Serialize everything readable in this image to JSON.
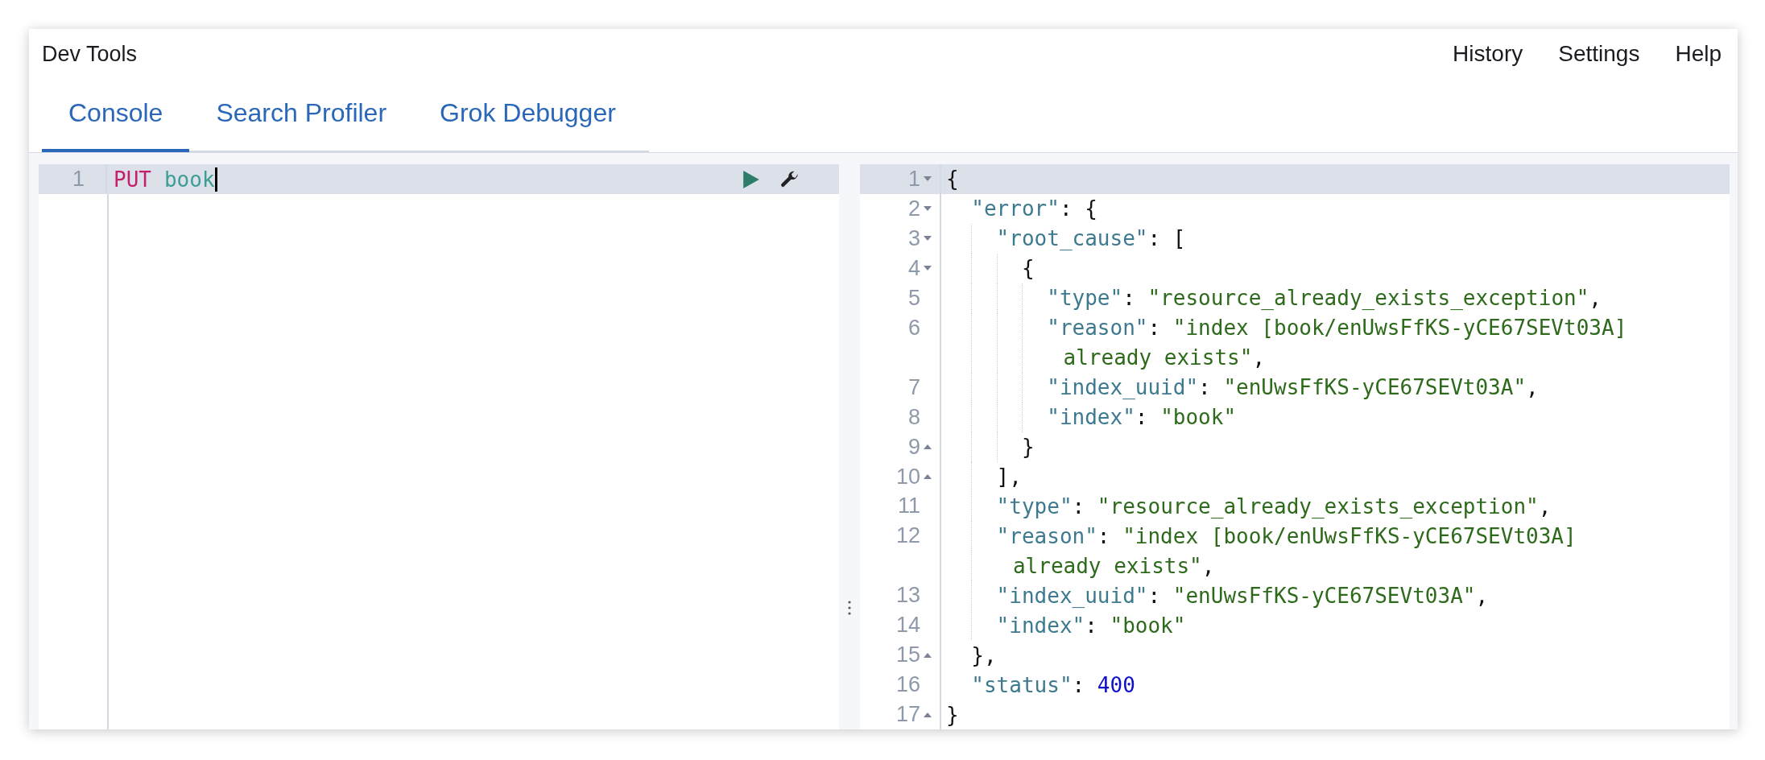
{
  "header": {
    "title": "Dev Tools",
    "links": [
      "History",
      "Settings",
      "Help"
    ]
  },
  "tabs": [
    {
      "label": "Console",
      "selected": true
    },
    {
      "label": "Search Profiler",
      "selected": false
    },
    {
      "label": "Grok Debugger",
      "selected": false
    }
  ],
  "request_editor": {
    "lines": [
      {
        "number": "1",
        "active": true,
        "tokens": [
          {
            "kind": "method",
            "text": "PUT"
          },
          {
            "kind": "url",
            "text": "book"
          }
        ]
      }
    ]
  },
  "response_editor": {
    "lines": [
      {
        "number": "1",
        "active": true,
        "fold_start": true,
        "fold_end": false,
        "tokens": [
          {
            "kind": "punct",
            "text": "{"
          }
        ]
      },
      {
        "number": "2",
        "active": false,
        "fold_start": true,
        "fold_end": false,
        "tokens": [
          {
            "kind": "key",
            "text": "  \"error\""
          },
          {
            "kind": "punct",
            "text": ": {"
          }
        ]
      },
      {
        "number": "3",
        "active": false,
        "fold_start": true,
        "fold_end": false,
        "tokens": [
          {
            "kind": "key",
            "text": "    \"root_cause\""
          },
          {
            "kind": "punct",
            "text": ": ["
          }
        ]
      },
      {
        "number": "4",
        "active": false,
        "fold_start": true,
        "fold_end": false,
        "tokens": [
          {
            "kind": "punct",
            "text": "      {"
          }
        ]
      },
      {
        "number": "5",
        "active": false,
        "fold_start": false,
        "fold_end": false,
        "tokens": [
          {
            "kind": "key",
            "text": "        \"type\""
          },
          {
            "kind": "punct",
            "text": ": "
          },
          {
            "kind": "string",
            "text": "\"resource_already_exists_exception\""
          },
          {
            "kind": "punct",
            "text": ","
          }
        ]
      },
      {
        "number": "6",
        "active": false,
        "fold_start": false,
        "fold_end": false,
        "tokens": [
          {
            "kind": "key",
            "text": "        \"reason\""
          },
          {
            "kind": "punct",
            "text": ": "
          },
          {
            "kind": "string",
            "text": "\"index [book/enUwsFfKS-yCE67SEVt03A]"
          }
        ],
        "wrapped": [
          {
            "kind": "string",
            "text": "already exists\""
          },
          {
            "kind": "punct",
            "text": ","
          }
        ]
      },
      {
        "number": "7",
        "active": false,
        "fold_start": false,
        "fold_end": false,
        "tokens": [
          {
            "kind": "key",
            "text": "        \"index_uuid\""
          },
          {
            "kind": "punct",
            "text": ": "
          },
          {
            "kind": "string",
            "text": "\"enUwsFfKS-yCE67SEVt03A\""
          },
          {
            "kind": "punct",
            "text": ","
          }
        ]
      },
      {
        "number": "8",
        "active": false,
        "fold_start": false,
        "fold_end": false,
        "tokens": [
          {
            "kind": "key",
            "text": "        \"index\""
          },
          {
            "kind": "punct",
            "text": ": "
          },
          {
            "kind": "string",
            "text": "\"book\""
          }
        ]
      },
      {
        "number": "9",
        "active": false,
        "fold_start": false,
        "fold_end": true,
        "tokens": [
          {
            "kind": "punct",
            "text": "      }"
          }
        ]
      },
      {
        "number": "10",
        "active": false,
        "fold_start": false,
        "fold_end": true,
        "tokens": [
          {
            "kind": "punct",
            "text": "    ],"
          }
        ]
      },
      {
        "number": "11",
        "active": false,
        "fold_start": false,
        "fold_end": false,
        "tokens": [
          {
            "kind": "key",
            "text": "    \"type\""
          },
          {
            "kind": "punct",
            "text": ": "
          },
          {
            "kind": "string",
            "text": "\"resource_already_exists_exception\""
          },
          {
            "kind": "punct",
            "text": ","
          }
        ]
      },
      {
        "number": "12",
        "active": false,
        "fold_start": false,
        "fold_end": false,
        "tokens": [
          {
            "kind": "key",
            "text": "    \"reason\""
          },
          {
            "kind": "punct",
            "text": ": "
          },
          {
            "kind": "string",
            "text": "\"index [book/enUwsFfKS-yCE67SEVt03A]"
          }
        ],
        "wrapped": [
          {
            "kind": "string",
            "text": "already exists\""
          },
          {
            "kind": "punct",
            "text": ","
          }
        ]
      },
      {
        "number": "13",
        "active": false,
        "fold_start": false,
        "fold_end": false,
        "tokens": [
          {
            "kind": "key",
            "text": "    \"index_uuid\""
          },
          {
            "kind": "punct",
            "text": ": "
          },
          {
            "kind": "string",
            "text": "\"enUwsFfKS-yCE67SEVt03A\""
          },
          {
            "kind": "punct",
            "text": ","
          }
        ]
      },
      {
        "number": "14",
        "active": false,
        "fold_start": false,
        "fold_end": false,
        "tokens": [
          {
            "kind": "key",
            "text": "    \"index\""
          },
          {
            "kind": "punct",
            "text": ": "
          },
          {
            "kind": "string",
            "text": "\"book\""
          }
        ]
      },
      {
        "number": "15",
        "active": false,
        "fold_start": false,
        "fold_end": true,
        "tokens": [
          {
            "kind": "punct",
            "text": "  },"
          }
        ]
      },
      {
        "number": "16",
        "active": false,
        "fold_start": false,
        "fold_end": false,
        "tokens": [
          {
            "kind": "key",
            "text": "  \"status\""
          },
          {
            "kind": "punct",
            "text": ": "
          },
          {
            "kind": "number",
            "text": "400"
          }
        ]
      },
      {
        "number": "17",
        "active": false,
        "fold_start": false,
        "fold_end": true,
        "tokens": [
          {
            "kind": "punct",
            "text": "}"
          }
        ]
      }
    ]
  }
}
